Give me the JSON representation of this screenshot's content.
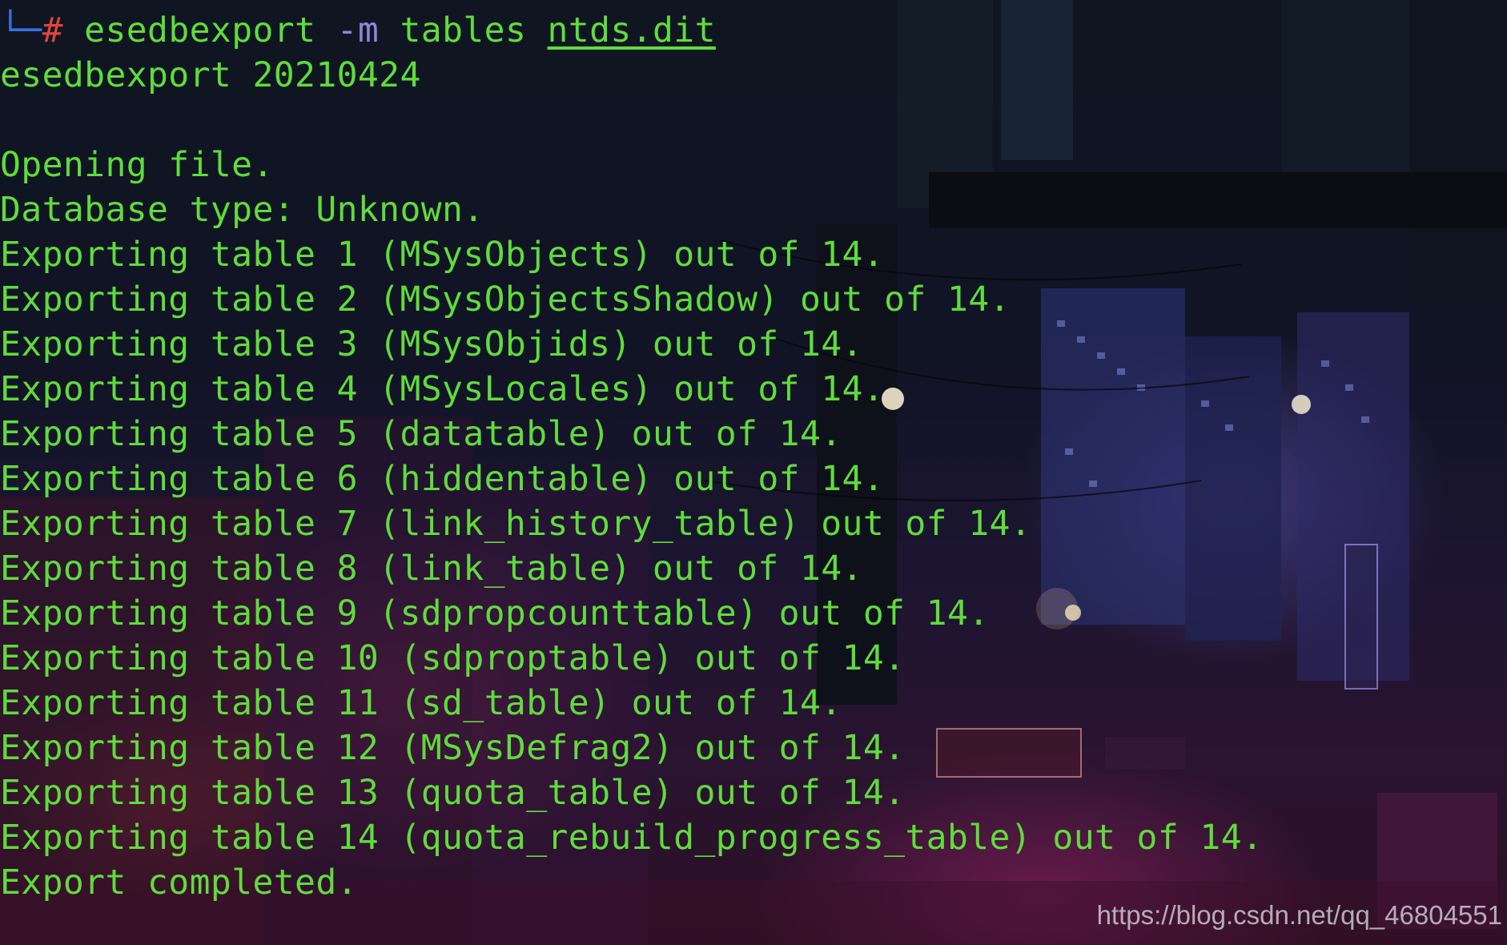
{
  "terminal": {
    "prompt": {
      "corner": "└─",
      "hash": "#"
    },
    "command": {
      "name": "esedbexport",
      "flag": "-m",
      "arg": "tables",
      "file": "ntds.dit"
    },
    "output": [
      "esedbexport 20210424",
      "",
      "Opening file.",
      "Database type: Unknown.",
      "Exporting table 1 (MSysObjects) out of 14.",
      "Exporting table 2 (MSysObjectsShadow) out of 14.",
      "Exporting table 3 (MSysObjids) out of 14.",
      "Exporting table 4 (MSysLocales) out of 14.",
      "Exporting table 5 (datatable) out of 14.",
      "Exporting table 6 (hiddentable) out of 14.",
      "Exporting table 7 (link_history_table) out of 14.",
      "Exporting table 8 (link_table) out of 14.",
      "Exporting table 9 (sdpropcounttable) out of 14.",
      "Exporting table 10 (sdproptable) out of 14.",
      "Exporting table 11 (sd_table) out of 14.",
      "Exporting table 12 (MSysDefrag2) out of 14.",
      "Exporting table 13 (quota_table) out of 14.",
      "Exporting table 14 (quota_rebuild_progress_table) out of 14.",
      "Export completed."
    ],
    "colors": {
      "text": "#5fdc3c",
      "prompt_corner": "#3b6fe0",
      "prompt_hash": "#e0453a",
      "flag": "#8f86d8"
    }
  },
  "watermark": "https://blog.csdn.net/qq_46804551"
}
